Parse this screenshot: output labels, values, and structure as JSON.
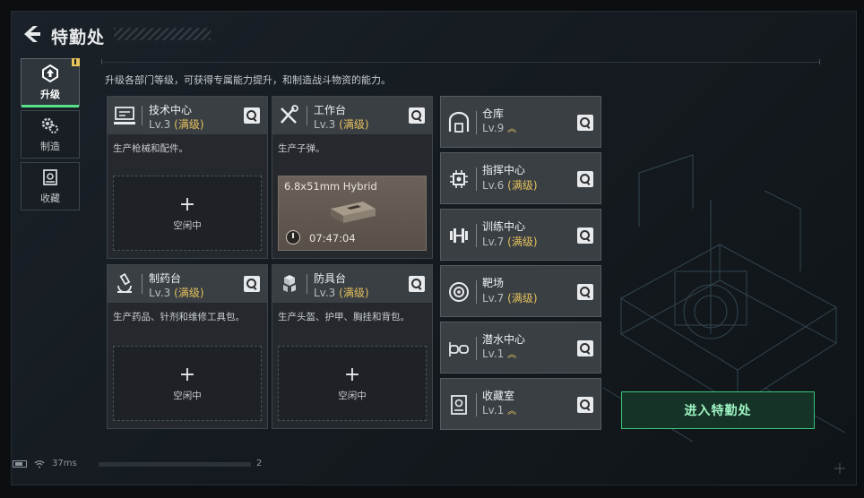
{
  "header": {
    "title": "特勤处",
    "back_label": ""
  },
  "sidebar": {
    "items": [
      {
        "label": "升级",
        "icon": "upgrade-icon",
        "active": true
      },
      {
        "label": "制造",
        "icon": "gears-icon",
        "active": false
      },
      {
        "label": "收藏",
        "icon": "collection-icon",
        "active": false
      }
    ]
  },
  "description": "升级各部门等级，可获得专属能力提升，和制造战斗物资的能力。",
  "panels": {
    "tech": {
      "name": "技术中心",
      "level": "Lv.3",
      "max": "(满级)",
      "desc": "生产枪械和配件。",
      "idle": "空闲中"
    },
    "workbench": {
      "name": "工作台",
      "level": "Lv.3",
      "max": "(满级)",
      "desc": "生产子弹。",
      "item": "6.8x51mm Hybrid",
      "time": "07:47:04"
    },
    "pharmacy": {
      "name": "制药台",
      "level": "Lv.3",
      "max": "(满级)",
      "desc": "生产药品、针剂和维修工具包。",
      "idle": "空闲中"
    },
    "armor": {
      "name": "防具台",
      "level": "Lv.3",
      "max": "(满级)",
      "desc": "生产头盔、护甲、胸挂和背包。",
      "idle": "空闲中"
    }
  },
  "right_panels": [
    {
      "name": "仓库",
      "level": "Lv.9",
      "max": "",
      "upgradable": true
    },
    {
      "name": "指挥中心",
      "level": "Lv.6",
      "max": "(满级)",
      "upgradable": false
    },
    {
      "name": "训练中心",
      "level": "Lv.7",
      "max": "(满级)",
      "upgradable": false
    },
    {
      "name": "靶场",
      "level": "Lv.7",
      "max": "(满级)",
      "upgradable": false
    },
    {
      "name": "潜水中心",
      "level": "Lv.1",
      "max": "",
      "upgradable": true
    },
    {
      "name": "收藏室",
      "level": "Lv.1",
      "max": "",
      "upgradable": true
    }
  ],
  "enter_button": "进入特勤处",
  "status": {
    "ping": "37ms",
    "page": "2"
  },
  "colors": {
    "accent": "#3bc47a",
    "max_level": "#e4c05c",
    "badge": "#e8c45a"
  }
}
